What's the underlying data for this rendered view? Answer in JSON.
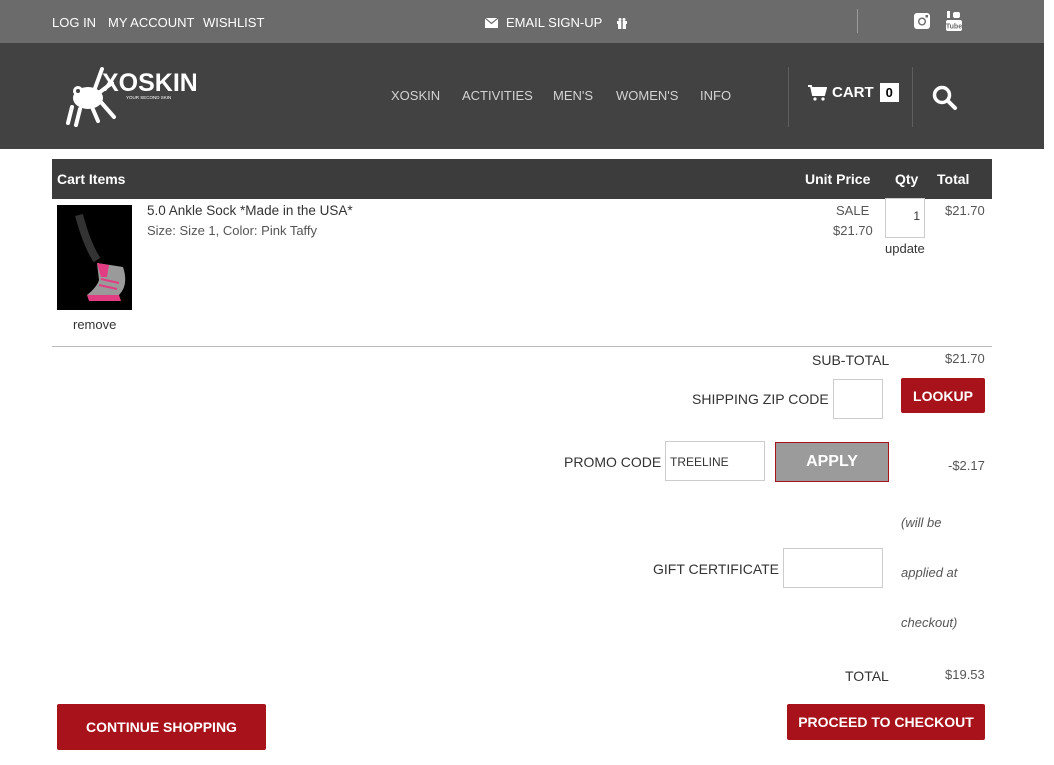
{
  "topbar": {
    "login": "LOG IN",
    "account": "MY ACCOUNT",
    "wishlist": "WISHLIST",
    "email_signup": "EMAIL SIGN-UP"
  },
  "header": {
    "nav": [
      "XOSKIN",
      "ACTIVITIES",
      "MEN'S",
      "WOMEN'S",
      "INFO"
    ],
    "cart_label": "CART",
    "cart_count": "0",
    "logo_text": "XOSKIN",
    "logo_tagline": "YOUR SECOND SKIN"
  },
  "table": {
    "col_items": "Cart Items",
    "col_unit_price": "Unit Price",
    "col_qty": "Qty",
    "col_total": "Total"
  },
  "item": {
    "name": "5.0 Ankle Sock *Made in the USA*",
    "options": "Size: Size 1, Color: Pink Taffy",
    "sale_label": "SALE",
    "unit_price": "$21.70",
    "qty": "1",
    "update_label": "update",
    "total": "$21.70",
    "remove_label": "remove"
  },
  "summary": {
    "subtotal_label": "SUB-TOTAL",
    "subtotal_value": "$21.70",
    "zip_label": "SHIPPING ZIP CODE",
    "lookup_label": "LOOKUP",
    "promo_label": "PROMO CODE",
    "promo_value": "TREELINE",
    "apply_label": "APPLY",
    "discount_value": "-$2.17",
    "gift_label": "GIFT CERTIFICATE",
    "gift_note_1": "(will be",
    "gift_note_2": "applied at",
    "gift_note_3": "checkout)",
    "total_label": "TOTAL",
    "total_value": "$19.53"
  },
  "actions": {
    "continue_label": "CONTINUE SHOPPING",
    "checkout_label": "PROCEED TO CHECKOUT"
  },
  "colors": {
    "topbar": "#6b6b6b",
    "header": "#424242",
    "accent_red": "#a8121b"
  }
}
